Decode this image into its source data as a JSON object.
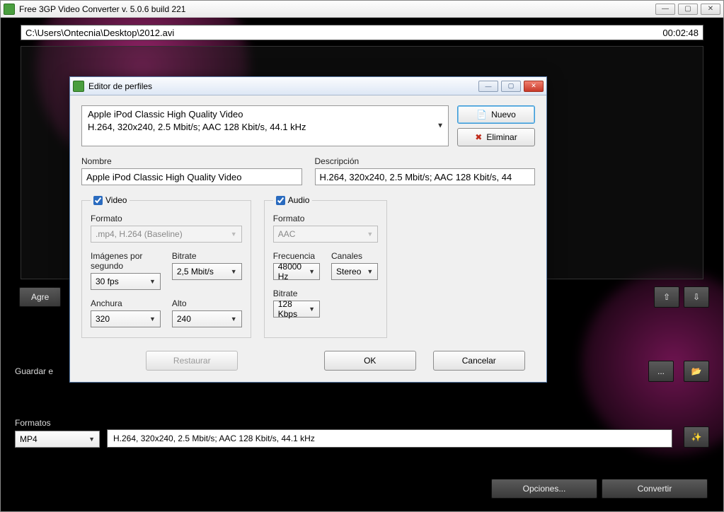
{
  "outer": {
    "title": "Free 3GP Video Converter  v. 5.0.6 build 221",
    "path": "C:\\Users\\Ontecnia\\Desktop\\2012.avi",
    "duration": "00:02:48"
  },
  "main": {
    "add_button": "Agre",
    "save_label": "Guardar e",
    "formats_label": "Formatos",
    "format_select": "MP4",
    "format_detail": "H.264, 320x240, 2.5 Mbit/s; AAC 128 Kbit/s, 44.1 kHz",
    "options_btn": "Opciones...",
    "convert_btn": "Convertir"
  },
  "dialog": {
    "title": "Editor de perfiles",
    "profile_line1": "Apple iPod Classic High Quality Video",
    "profile_line2": "H.264, 320x240, 2.5 Mbit/s; AAC 128 Kbit/s, 44.1 kHz",
    "new_btn": "Nuevo",
    "delete_btn": "Eliminar",
    "name_label": "Nombre",
    "name_value": "Apple iPod Classic High Quality Video",
    "desc_label": "Descripción",
    "desc_value": "H.264, 320x240, 2.5 Mbit/s; AAC 128 Kbit/s, 44",
    "video": {
      "legend": "Video",
      "format_label": "Formato",
      "format_value": ".mp4, H.264 (Baseline)",
      "fps_label": "Imágenes por segundo",
      "fps_value": "30 fps",
      "bitrate_label": "Bitrate",
      "bitrate_value": "2,5 Mbit/s",
      "width_label": "Anchura",
      "width_value": "320",
      "height_label": "Alto",
      "height_value": "240"
    },
    "audio": {
      "legend": "Audio",
      "format_label": "Formato",
      "format_value": "AAC",
      "freq_label": "Frecuencia",
      "freq_value": "48000 Hz",
      "channels_label": "Canales",
      "channels_value": "Stereo",
      "bitrate_label": "Bitrate",
      "bitrate_value": "128 Kbps"
    },
    "restore_btn": "Restaurar",
    "ok_btn": "OK",
    "cancel_btn": "Cancelar"
  }
}
